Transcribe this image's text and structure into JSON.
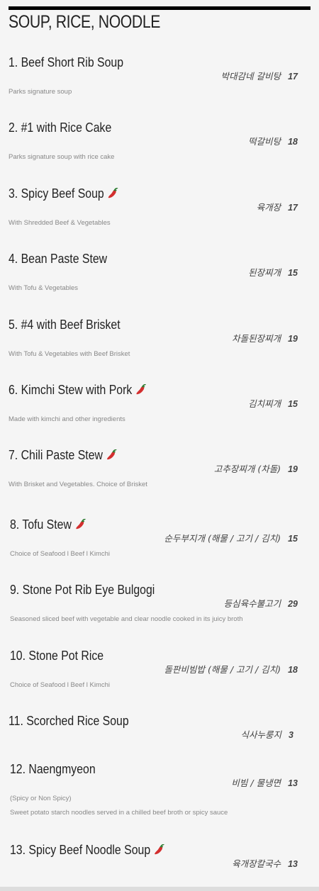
{
  "section": {
    "title": "SOUP, RICE, NOODLE"
  },
  "items": [
    {
      "name": "1. Beef Short Rib Soup",
      "korean": "박대감네 갈비탕",
      "price": "17",
      "desc": "Parks signature soup",
      "spicy": false
    },
    {
      "name": "2. #1 with Rice Cake",
      "korean": "떡갈비탕",
      "price": "18",
      "desc": "Parks signature soup with rice cake",
      "spicy": false
    },
    {
      "name": "3. Spicy Beef Soup",
      "korean": "육개장",
      "price": "17",
      "desc": "With Shredded Beef & Vegetables",
      "spicy": true
    },
    {
      "name": "4. Bean Paste Stew",
      "korean": "된장찌개",
      "price": "15",
      "desc": "With Tofu & Vegetables",
      "spicy": false
    },
    {
      "name": "5. #4 with Beef Brisket",
      "korean": "차돌된장찌개",
      "price": "19",
      "desc": "With Tofu & Vegetables with Beef Brisket",
      "spicy": false
    },
    {
      "name": "6. Kimchi Stew with Pork",
      "korean": "김치찌개",
      "price": "15",
      "desc": "Made with kimchi and other ingredients",
      "spicy": true
    },
    {
      "name": "7. Chili Paste Stew",
      "korean": "고추장찌개 (차돌)",
      "price": "19",
      "desc": "With Brisket and Vegetables. Choice of Brisket",
      "spicy": true
    },
    {
      "name": "8. Tofu Stew",
      "korean": "순두부지개 (해물 / 고기 / 김치)",
      "price": "15",
      "desc": "Choice of Seafood l Beef l Kimchi",
      "spicy": true
    },
    {
      "name": "9. Stone Pot Rib Eye Bulgogi",
      "korean": "등심육수불고기",
      "price": "29",
      "desc": "Seasoned sliced beef with vegetable and clear noodle cooked in its juicy broth",
      "spicy": false
    },
    {
      "name": "10. Stone Pot Rice",
      "korean": "돌판비빔밥 (해물 / 고기 / 김치)",
      "price": "18",
      "desc": "Choice of Seafood l Beef l Kimchi",
      "spicy": false
    },
    {
      "name": "11. Scorched Rice Soup",
      "korean": "식사누룽지",
      "price": "3",
      "desc": "",
      "spicy": false
    },
    {
      "name": "12. Naengmyeon",
      "korean": "비빔 / 물냉면",
      "price": "13",
      "desc": "(Spicy or Non Spicy)",
      "desc2": "Sweet potato starch noodles served in a chilled beef broth or spicy sauce",
      "spicy": false
    },
    {
      "name": "13. Spicy Beef Noodle Soup",
      "korean": "육개장칼국수",
      "price": "13",
      "desc": "",
      "spicy": true
    }
  ],
  "colors": {
    "text": "#222222",
    "desc": "#888888",
    "pepper": "#d32f2f"
  },
  "icons": {
    "spicy": "chili-pepper-icon"
  }
}
